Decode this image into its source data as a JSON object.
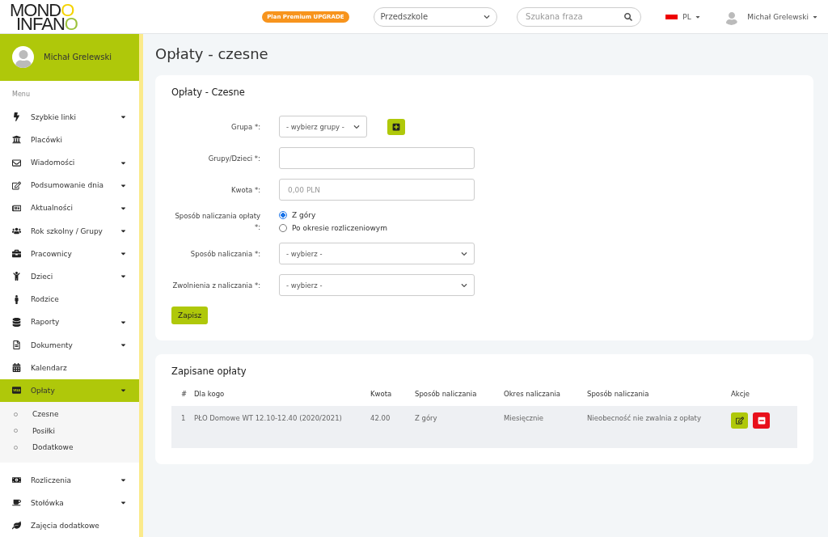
{
  "logo": {
    "lines": [
      "MONDO",
      "INFANO"
    ]
  },
  "header": {
    "upgrade": "Plan Premium UPGRADE",
    "facility_select": "Przedszkole",
    "search": {
      "placeholder": "Szukana fraza"
    },
    "language": "PL",
    "user": "Michał Grelewski"
  },
  "sidebar": {
    "user": "Michał Grelewski",
    "menu_label": "Menu",
    "items": [
      {
        "label": "Szybkie linki",
        "expandable": true,
        "selected": false
      },
      {
        "label": "Placówki",
        "expandable": false,
        "selected": false
      },
      {
        "label": "Wiadomości",
        "expandable": true,
        "selected": false
      },
      {
        "label": "Podsumowanie dnia",
        "expandable": true,
        "selected": false
      },
      {
        "label": "Aktualności",
        "expandable": true,
        "selected": false
      },
      {
        "label": "Rok szkolny / Grupy",
        "expandable": true,
        "selected": false
      },
      {
        "label": "Pracownicy",
        "expandable": true,
        "selected": false
      },
      {
        "label": "Dzieci",
        "expandable": true,
        "selected": false
      },
      {
        "label": "Rodzice",
        "expandable": false,
        "selected": false
      },
      {
        "label": "Raporty",
        "expandable": true,
        "selected": false
      },
      {
        "label": "Dokumenty",
        "expandable": true,
        "selected": false
      },
      {
        "label": "Kalendarz",
        "expandable": false,
        "selected": false
      },
      {
        "label": "Opłaty",
        "expandable": true,
        "selected": true,
        "expanded": true,
        "children": [
          {
            "label": "Czesne"
          },
          {
            "label": "Posiłki"
          },
          {
            "label": "Dodatkowe"
          }
        ]
      },
      {
        "label": "Rozliczenia",
        "expandable": true,
        "selected": false
      },
      {
        "label": "Stołówka",
        "expandable": true,
        "selected": false
      },
      {
        "label": "Zajęcia dodatkowe",
        "expandable": false,
        "selected": false
      }
    ]
  },
  "page_title": "Opłaty - czesne",
  "form": {
    "title": "Opłaty - Czesne",
    "fields": [
      {
        "kind": "select",
        "label": "Grupa *:",
        "value": "- wybierz grupy -",
        "add_button": true
      },
      {
        "kind": "input",
        "label": "Grupy/Dzieci *:"
      },
      {
        "kind": "input",
        "label": "Kwota *:",
        "placeholder": "0,00 PLN"
      },
      {
        "kind": "radio",
        "label": "Sposób naliczania opłaty *:",
        "options": [
          {
            "label": "Z góry",
            "selected": true
          },
          {
            "label": "Po okresie rozliczeniowym",
            "selected": false
          }
        ]
      },
      {
        "kind": "select",
        "label": "Sposób naliczania *:",
        "value": "- wybierz -"
      },
      {
        "kind": "select",
        "label": "Zwolnienia z naliczania *:",
        "value": "- wybierz -"
      }
    ],
    "submit": "Zapisz"
  },
  "table": {
    "title": "Zapisane opłaty",
    "columns": [
      "#",
      "Dla kogo",
      "Kwota",
      "Sposób naliczania",
      "Okres naliczania",
      "Sposób naliczania",
      "Akcje"
    ],
    "rows": [
      [
        "1",
        "PŁO Domowe WT 12.10-12.40 (2020/2021)",
        "42.00",
        "Z góry",
        "Miesięcznie",
        "Nieobecność nie zwalnia z opłaty"
      ]
    ]
  }
}
